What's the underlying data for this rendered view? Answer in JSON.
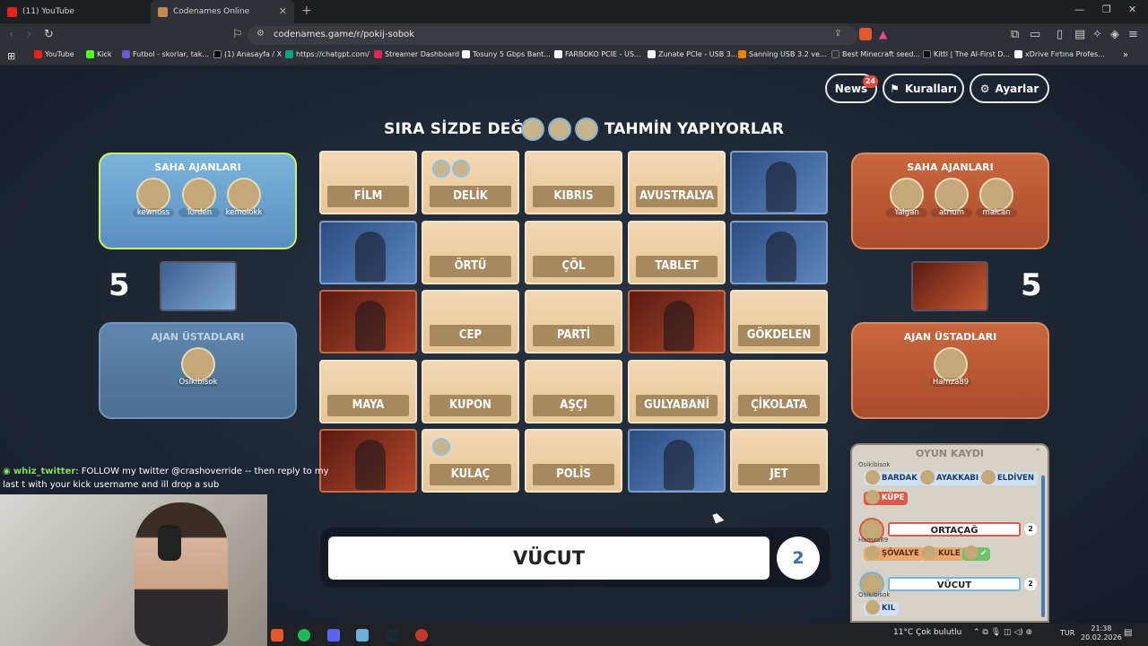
{
  "browser": {
    "tabs": [
      {
        "title": "(11) YouTube",
        "fav_color": "#e62117"
      },
      {
        "title": "Codenames Online",
        "fav_color": "#c48a52"
      }
    ],
    "url": "codenames.game/r/pokij-sobok",
    "bookmarks": [
      {
        "label": "YouTube",
        "color": "#e62117"
      },
      {
        "label": "Kick",
        "color": "#53fc18"
      },
      {
        "label": "Futbol - skorlar, tak...",
        "color": "#6a5acd"
      },
      {
        "label": "(1) Anasayfa / X",
        "color": "#000000"
      },
      {
        "label": "https://chatgpt.com/",
        "color": "#10a37f"
      },
      {
        "label": "Streamer Dashboard",
        "color": "#e0245e"
      },
      {
        "label": "Tosuny 5 Gbps Bant...",
        "color": "#ffffff"
      },
      {
        "label": "FARBOKO PCIE - US...",
        "color": "#ffffff"
      },
      {
        "label": "Zunate PCIe - USB 3...",
        "color": "#ffffff"
      },
      {
        "label": "Sanning USB 3.2 ve...",
        "color": "#f08000"
      },
      {
        "label": "Best Minecraft seed...",
        "color": "#333333"
      },
      {
        "label": "Kittl | The AI-First D...",
        "color": "#111111"
      },
      {
        "label": "xDrive Fırtına Profes...",
        "color": "#ffffff"
      }
    ]
  },
  "game": {
    "news_label": "News",
    "news_count": "24",
    "rules_label": "Kuralları",
    "settings_label": "Ayarlar",
    "turn_text": "SIRA SİZDE DEĞİL,",
    "turn_text2": "TAHMİN YAPIYORLAR",
    "turn_players": [
      "kewnoss",
      "Torden",
      "kemolokk"
    ],
    "blue": {
      "operatives_title": "SAHA AJANLARI",
      "operatives": [
        "kewnoss",
        "Torden",
        "kemolokk"
      ],
      "score": "5",
      "spymasters_title": "AJAN ÜSTADLARI",
      "spymasters": [
        "Osikibisok"
      ]
    },
    "red": {
      "operatives_title": "SAHA AJANLARI",
      "operatives": [
        "Yalgan",
        "atrium",
        "malcan"
      ],
      "score": "5",
      "spymasters_title": "AJAN ÜSTADLARI",
      "spymasters": [
        "Hamza89"
      ]
    },
    "board": [
      {
        "word": "FİLM",
        "type": "word"
      },
      {
        "word": "DELİK",
        "type": "word",
        "tokens": [
          "kewnoss",
          "kemolokk"
        ]
      },
      {
        "word": "KIBRIS",
        "type": "word"
      },
      {
        "word": "AVUSTRALYA",
        "type": "word"
      },
      {
        "word": "",
        "type": "blue"
      },
      {
        "word": "",
        "type": "blue"
      },
      {
        "word": "ÖRTÜ",
        "type": "word"
      },
      {
        "word": "ÇÖL",
        "type": "word"
      },
      {
        "word": "TABLET",
        "type": "word"
      },
      {
        "word": "",
        "type": "blue"
      },
      {
        "word": "",
        "type": "red"
      },
      {
        "word": "CEP",
        "type": "word"
      },
      {
        "word": "PARTİ",
        "type": "word"
      },
      {
        "word": "",
        "type": "red"
      },
      {
        "word": "GÖKDELEN",
        "type": "word"
      },
      {
        "word": "MAYA",
        "type": "word"
      },
      {
        "word": "KUPON",
        "type": "word"
      },
      {
        "word": "AŞÇI",
        "type": "word"
      },
      {
        "word": "GULYABANİ",
        "type": "word"
      },
      {
        "word": "ÇİKOLATA",
        "type": "word"
      },
      {
        "word": "",
        "type": "red"
      },
      {
        "word": "KULAÇ",
        "type": "word",
        "tokens": [
          "kemolokk"
        ]
      },
      {
        "word": "POLİS",
        "type": "word"
      },
      {
        "word": "",
        "type": "blue"
      },
      {
        "word": "JET",
        "type": "word"
      }
    ],
    "clue": {
      "word": "VÜCUT",
      "number": "2"
    },
    "log": {
      "title": "OYUN KAYDI",
      "top_name": "Osikibisok",
      "guesses_blue_1": [
        "BARDAK",
        "AYAKKABI",
        "ELDİVEN"
      ],
      "guess_red_1": "KÜPE",
      "clue_red": {
        "player": "Hamza89",
        "word": "ORTAÇAĞ",
        "number": "2"
      },
      "guesses_red": [
        "ŞÖVALYE",
        "KULE"
      ],
      "clue_blue": {
        "player": "Osikibisok",
        "word": "VÜCUT",
        "number": "2"
      },
      "guess_blue_2": "KIL"
    }
  },
  "chat": {
    "user": "whiz_twitter",
    "message": ": FOLLOW my twitter @crashoverride -- then reply to my last t with your kick username and ill drop a sub"
  },
  "taskbar": {
    "weather": "11°C Çok bulutlu",
    "lang": "TUR",
    "time": "21:38",
    "date": "20.02.2026"
  }
}
